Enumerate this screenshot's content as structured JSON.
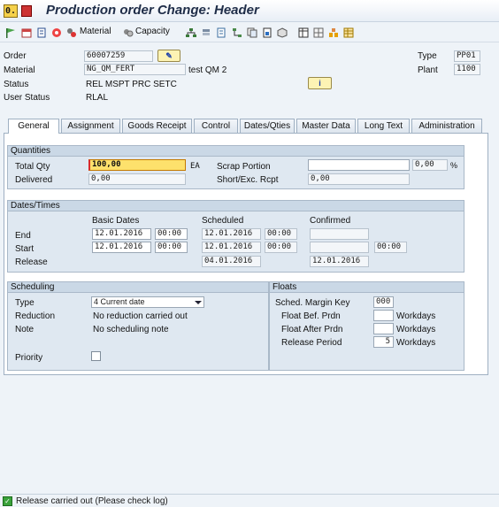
{
  "window": {
    "title": "Production order Change: Header",
    "command_field": "0."
  },
  "toolbar": {
    "material_label": "Material",
    "capacity_label": "Capacity"
  },
  "header": {
    "order_label": "Order",
    "order_value": "60007259",
    "type_label": "Type",
    "type_value": "PP01",
    "material_label": "Material",
    "material_value": "NG_QM_FERT",
    "material_desc": "test QM 2",
    "plant_label": "Plant",
    "plant_value": "1100",
    "status_label": "Status",
    "status_value": "REL  MSPT PRC  SETC",
    "user_status_label": "User Status",
    "user_status_value": "RLAL"
  },
  "tabs": [
    {
      "label": "General",
      "active": true
    },
    {
      "label": "Assignment",
      "active": false
    },
    {
      "label": "Goods Receipt",
      "active": false
    },
    {
      "label": "Control",
      "active": false
    },
    {
      "label": "Dates/Qties",
      "active": false
    },
    {
      "label": "Master Data",
      "active": false
    },
    {
      "label": "Long Text",
      "active": false
    },
    {
      "label": "Administration",
      "active": false
    }
  ],
  "quantities": {
    "title": "Quantities",
    "total_qty_label": "Total Qty",
    "total_qty_value": "100,00",
    "unit": "EA",
    "scrap_label": "Scrap Portion",
    "scrap_value": "",
    "scrap_pct": "0,00",
    "pct_sign": "%",
    "delivered_label": "Delivered",
    "delivered_value": "0,00",
    "short_label": "Short/Exc. Rcpt",
    "short_value": "0,00"
  },
  "dates": {
    "title": "Dates/Times",
    "col_basic": "Basic Dates",
    "col_scheduled": "Scheduled",
    "col_confirmed": "Confirmed",
    "end_label": "End",
    "start_label": "Start",
    "release_label": "Release",
    "end_basic_date": "12.01.2016",
    "end_basic_time": "00:00",
    "end_sched_date": "12.01.2016",
    "end_sched_time": "00:00",
    "end_confirmed": "",
    "start_basic_date": "12.01.2016",
    "start_basic_time": "00:00",
    "start_sched_date": "12.01.2016",
    "start_sched_time": "00:00",
    "start_confirmed": "",
    "start_confirmed_time": "00:00",
    "release_sched": "04.01.2016",
    "release_confirmed": "12.01.2016"
  },
  "scheduling": {
    "title": "Scheduling",
    "type_label": "Type",
    "type_value": "4 Current date",
    "reduction_label": "Reduction",
    "reduction_value": "No reduction carried out",
    "note_label": "Note",
    "note_value": "No scheduling note",
    "priority_label": "Priority"
  },
  "floats": {
    "title": "Floats",
    "margin_key_label": "Sched. Margin Key",
    "margin_key_value": "000",
    "float_bef_label": "Float Bef. Prdn",
    "float_bef_value": "",
    "float_after_label": "Float After Prdn",
    "float_after_value": "",
    "release_period_label": "Release Period",
    "release_period_value": "5",
    "workdays": "Workdays"
  },
  "status_bar": {
    "message": "Release carried out (Please check log)"
  },
  "colors": {
    "accent_focus": "#fde16c",
    "group_bg": "#dfe8f1",
    "success": "#3aa23a"
  }
}
